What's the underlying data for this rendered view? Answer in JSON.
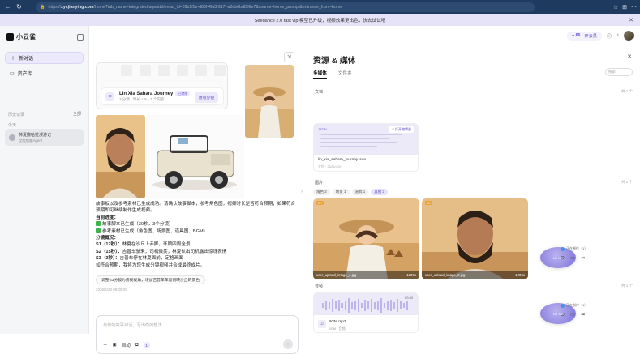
{
  "browser": {
    "url_host": "https://",
    "url_bold": "xycjianying.com",
    "url_rest": "/home?tab_name=integrated-agent&thread_id=09b1f5e-d85f-4fa3-917f-a3ab6bd886e7&source=home_prompt&entrance_from=home"
  },
  "banner": {
    "text": "Seedance 2.0 fast vip 模型已升级，视频效果更出色，快去试试吧",
    "close": "✕"
  },
  "sidebar": {
    "logo": "小云雀",
    "new_chat": "新对话",
    "assets": "资产库",
    "recent_label": "历史记录",
    "all": "全部",
    "today": "今天",
    "conversation_title": "林夏撒哈拉漫游记",
    "conversation_sub": "全能智能Agent"
  },
  "chat": {
    "project_title": "Lin Xia Sahara Journey",
    "project_tag": "已就绪",
    "project_meta": "3 分镜 · 时长 12s · 1 个内容",
    "open_button": "放看分镜",
    "intro": "故事板以及参考素材已生成成功。请确认故事脚本，参考角色图，视频时长是否符合预期，如果符合预期即可继续制作生成视频。",
    "progress_title": "当前进度：",
    "step1": "故事脚本已生成（30秒，3个分镜）",
    "step2": "参考素材已生成（角色图、场景图、道具图、BGM）",
    "shots_title": "分镜概况：",
    "shot1_label": "S1（12秒）：",
    "shot1_text": "林夏在沙丘上赤脚，环顾四周全景",
    "shot2_label": "S2（15秒）：",
    "shot2_text": "吉普车驶来，司机微笑，林夏认出司机露出惊讶表情",
    "shot3_label": "S3（3秒）：",
    "shot3_text": "吉普车停在林夏面前，定格画面",
    "closing": "如符合预期，我将为您生成分镜视频并合成最终成片。",
    "suggestion_chip": "调整S3分镜为俯视视角，增加吉普车车窗倒映沙丘的景色",
    "timestamp": "2026/4/20 09:05:09",
    "composer_placeholder": "与你的故事对话，写出你的想法…",
    "tool_auto": "自动",
    "tool_count": "1",
    "send": "↑"
  },
  "header": {
    "credits": "+ 66",
    "credits_label": "开会员"
  },
  "resources": {
    "title": "资源 & 媒体",
    "tabs": [
      "多媒体",
      "文件夹"
    ],
    "search_placeholder": "搜索",
    "doc_section": "文档",
    "doc_count": "共 1 个",
    "doc_name": "lin_xia_sahara_journey.json",
    "doc_meta": "文档 · 2026/4/20",
    "doc_preview_label": "JSON",
    "doc_open": "↗ 打开编辑器",
    "img_section": "图片",
    "img_count": "共 2 个",
    "filters": [
      "角色 2",
      "场景 1",
      "道具 1",
      "其他 2"
    ],
    "img1_badge": "2K",
    "img1_name": "user_upload_image_1.jpg",
    "img1_size": "1200x",
    "img2_badge": "2K",
    "img2_name": "user_upload_image_2.jpg",
    "img2_size": "1200x",
    "audio_section": "音频",
    "audio_count": "共 1 个",
    "audio_duration": "00:30",
    "audio_name": "BGM.mp3",
    "audio_meta": "BGM · 音频"
  },
  "floats": [
    {
      "label": "Lin Xia",
      "tag": "正在制作（1）"
    },
    {
      "label": "Lin Xia",
      "tag": "正在制作（1）"
    }
  ]
}
